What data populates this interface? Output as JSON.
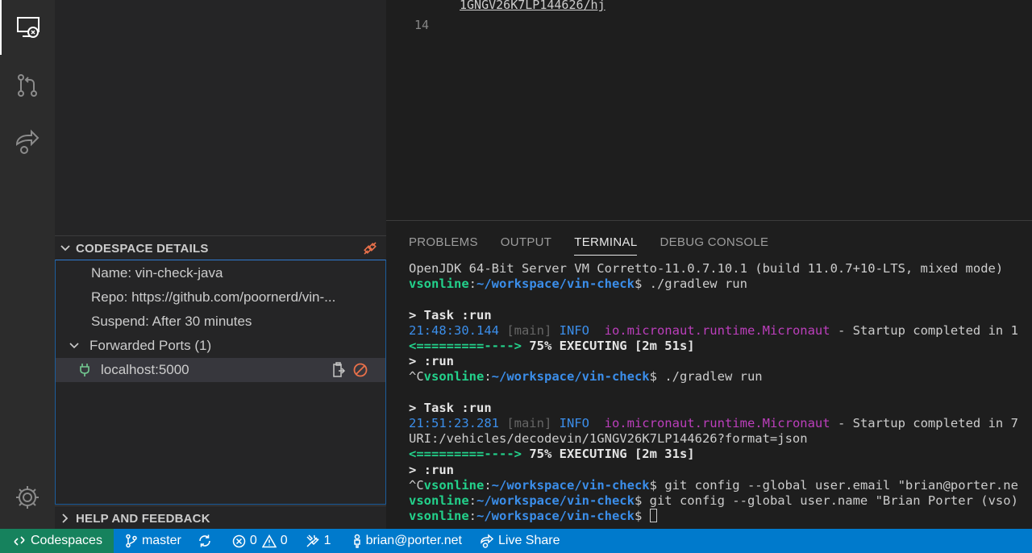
{
  "activity_bar": {
    "items": [
      {
        "icon": "remote-explorer-icon",
        "active": true
      },
      {
        "icon": "source-control-icon"
      },
      {
        "icon": "live-share-icon"
      }
    ],
    "bottom_icon": "gear-icon"
  },
  "sidebar": {
    "codespace_details": {
      "title": "CODESPACE DETAILS",
      "name": "Name: vin-check-java",
      "repo": "Repo: https://github.com/poornerd/vin-...",
      "suspend": "Suspend: After 30 minutes",
      "forwarded_ports": "Forwarded Ports (1)",
      "port": "localhost:5000"
    },
    "help": {
      "title": "HELP AND FEEDBACK"
    }
  },
  "editor": {
    "line_text": "1GNGV26K7LP144626/hj",
    "line_number": "14"
  },
  "panel": {
    "tabs": [
      "PROBLEMS",
      "OUTPUT",
      "TERMINAL",
      "DEBUG CONSOLE"
    ],
    "active_tab": "TERMINAL",
    "terminal": {
      "l1": "OpenJDK 64-Bit Server VM Corretto-11.0.7.10.1 (build 11.0.7+10-LTS, mixed mode)",
      "user": "vsonline",
      "path": "~/workspace/vin-check",
      "prompt": "$ ",
      "ctrl_c": "^C",
      "cmd_run": "./gradlew run",
      "task": "> Task :run",
      "time1": "21:48:30.144",
      "time2": "21:51:23.281",
      "thread": " [main] ",
      "level": "INFO ",
      "logger": " io.micronaut.runtime.Micronaut",
      "msg1": " - Startup completed in 1",
      "msg2": " - Startup completed in 7",
      "progress_arrow": "<=========---->",
      "progress1": " 75% EXECUTING [2m 51s]",
      "progress2": " 75% EXECUTING [2m 31s]",
      "run": "> :run",
      "uri": "URI:/vehicles/decodevin/1GNGV26K7LP144626?format=json",
      "cmd_email": "git config --global user.email \"brian@porter.ne",
      "cmd_name": "git config --global user.name \"Brian Porter (vso)"
    }
  },
  "status_bar": {
    "remote": "Codespaces",
    "branch": "master",
    "errors": "0",
    "warnings": "0",
    "tools": "1",
    "user": "brian@porter.net",
    "live_share": "Live Share",
    "colors": {
      "bar": "#007acc",
      "remote": "#16825d"
    }
  }
}
